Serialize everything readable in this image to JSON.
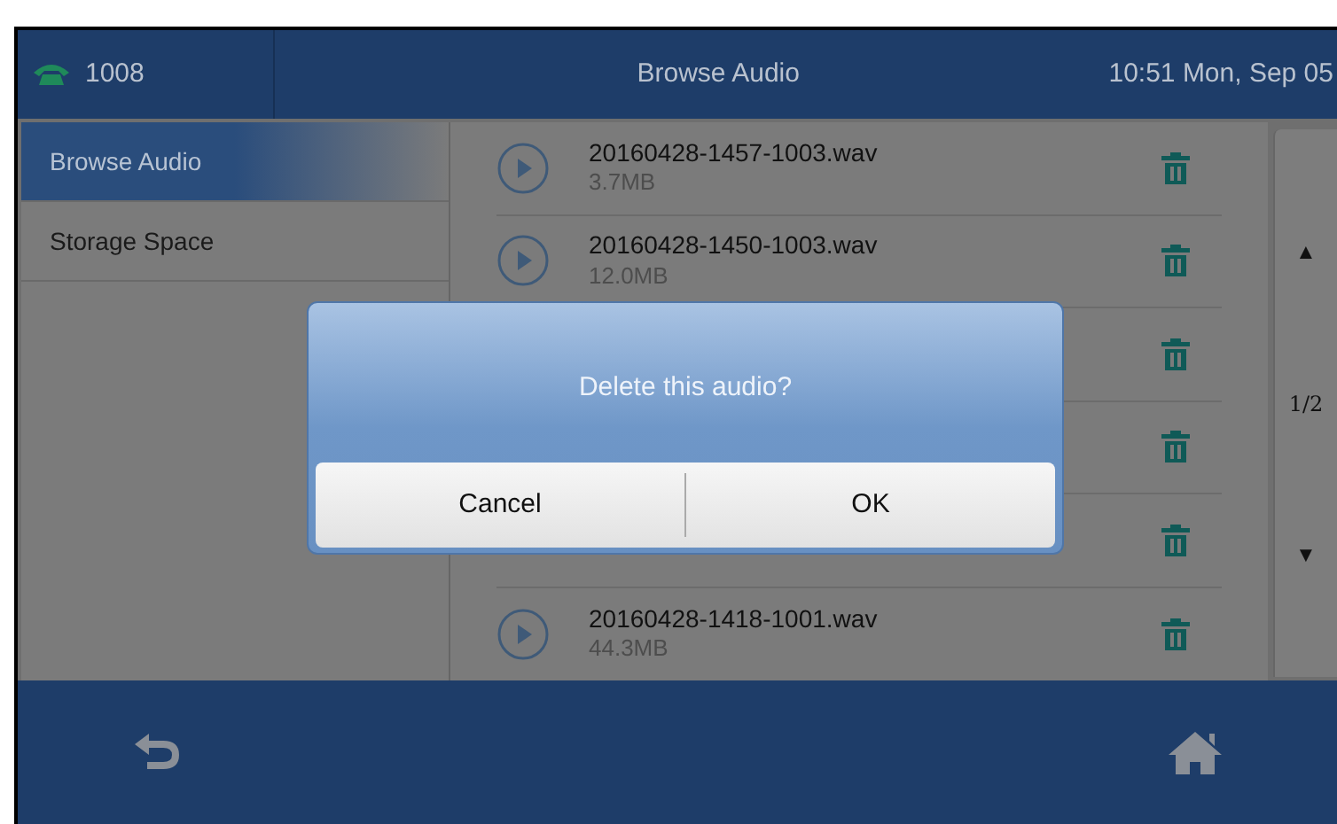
{
  "header": {
    "line": "1008",
    "title": "Browse Audio",
    "clock": "10:51 Mon, Sep 05"
  },
  "sidebar": {
    "items": [
      {
        "label": "Browse Audio",
        "selected": true
      },
      {
        "label": "Storage Space",
        "selected": false
      }
    ]
  },
  "files": [
    {
      "kind": "file",
      "name": "20160428-1457-1003.wav",
      "size": "3.7MB"
    },
    {
      "kind": "file",
      "name": "20160428-1450-1003.wav",
      "size": "12.0MB"
    },
    {
      "kind": "covered"
    },
    {
      "kind": "covered"
    },
    {
      "kind": "covered"
    },
    {
      "kind": "file",
      "name": "20160428-1418-1001.wav",
      "size": "44.3MB"
    }
  ],
  "pager": {
    "up": "▲",
    "page": "1/2",
    "down": "▼"
  },
  "dialog": {
    "message": "Delete this audio?",
    "buttons": [
      "Cancel",
      "OK"
    ]
  }
}
